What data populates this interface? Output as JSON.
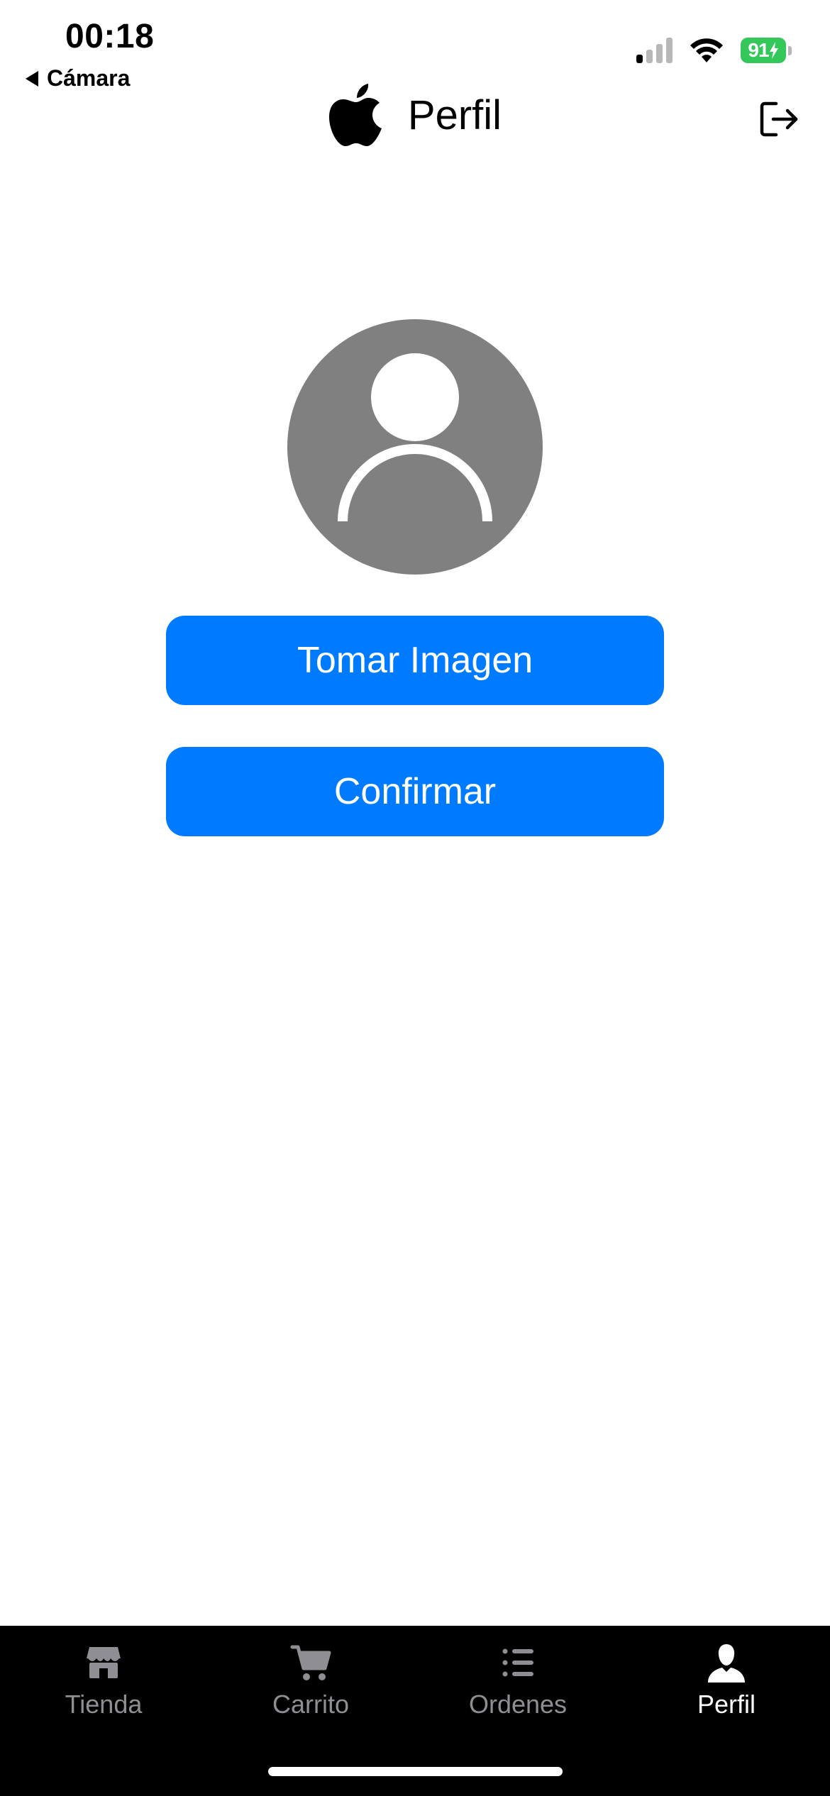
{
  "status_bar": {
    "time": "00:18",
    "back_app": "Cámara",
    "battery_level": "91"
  },
  "nav": {
    "title": "Perfil"
  },
  "main": {
    "take_image_label": "Tomar Imagen",
    "confirm_label": "Confirmar"
  },
  "tab_bar": {
    "tabs": [
      {
        "label": "Tienda",
        "icon": "store-icon",
        "active": false
      },
      {
        "label": "Carrito",
        "icon": "cart-icon",
        "active": false
      },
      {
        "label": "Ordenes",
        "icon": "list-icon",
        "active": false
      },
      {
        "label": "Perfil",
        "icon": "person-icon",
        "active": true
      }
    ]
  },
  "colors": {
    "accent": "#007aff",
    "avatar_bg": "#808080",
    "battery": "#34c759",
    "tabbar_bg": "#000000",
    "tab_inactive": "#8e8e93",
    "tab_active": "#ffffff"
  }
}
